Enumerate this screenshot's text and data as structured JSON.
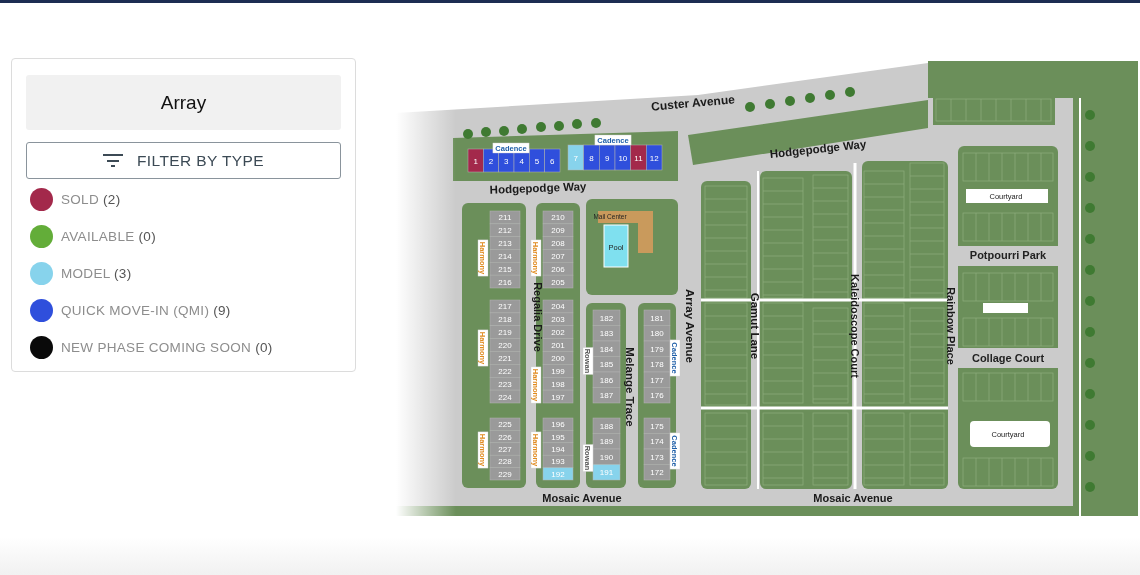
{
  "panel": {
    "title": "Array",
    "filter_button": "FILTER BY TYPE",
    "legend": [
      {
        "label": "SOLD",
        "count": "(2)",
        "color": "#a3294b"
      },
      {
        "label": "AVAILABLE",
        "count": "(0)",
        "color": "#63ad39"
      },
      {
        "label": "MODEL",
        "count": "(3)",
        "color": "#87d3ec"
      },
      {
        "label": "QUICK MOVE-IN (QMI)",
        "count": "(9)",
        "color": "#2f4fdc"
      },
      {
        "label": "NEW PHASE COMING SOON",
        "count": "(0)",
        "color": "#0a0a0a"
      }
    ]
  },
  "map": {
    "streets": [
      "Custer Avenue",
      "Hodgepodge Way",
      "Hodgepodge Way",
      "Regalia Drive",
      "Melange Trace",
      "Array Avenue",
      "Gamut Lane",
      "Kaleidoscope Court",
      "Rainbow Place",
      "Mosaic Avenue",
      "Mosaic Avenue"
    ],
    "places": [
      "Mail Center",
      "Pool",
      "Courtyard",
      "Potpourri Park",
      "Collage Court",
      "Courtyard"
    ],
    "builder_tags": [
      {
        "text": "Cadence",
        "color": "#1f5fa8"
      },
      {
        "text": "Cadence",
        "color": "#1f5fa8"
      },
      {
        "text": "Cadence",
        "color": "#1f5fa8"
      },
      {
        "text": "Cadence",
        "color": "#1f5fa8"
      },
      {
        "text": "Harmony",
        "color": "#e08a1e"
      },
      {
        "text": "Harmony",
        "color": "#e08a1e"
      },
      {
        "text": "Harmony",
        "color": "#e08a1e"
      },
      {
        "text": "Harmony",
        "color": "#e08a1e"
      },
      {
        "text": "Harmony",
        "color": "#e08a1e"
      },
      {
        "text": "Harmony",
        "color": "#e08a1e"
      },
      {
        "text": "Rowan",
        "color": "#555555"
      },
      {
        "text": "Rowan",
        "color": "#555555"
      }
    ],
    "lot_blocks": [
      {
        "lots": [
          {
            "number": "1",
            "color": "#a3294b"
          },
          {
            "number": "2",
            "color": "#2f4fdc"
          },
          {
            "number": "3",
            "color": "#2f4fdc"
          },
          {
            "number": "4",
            "color": "#2f4fdc"
          },
          {
            "number": "5",
            "color": "#2f4fdc"
          },
          {
            "number": "6",
            "color": "#2f4fdc"
          }
        ]
      },
      {
        "lots": [
          {
            "number": "7",
            "color": "#87d3ec"
          },
          {
            "number": "8",
            "color": "#2f4fdc"
          },
          {
            "number": "9",
            "color": "#2f4fdc"
          },
          {
            "number": "10",
            "color": "#2f4fdc"
          },
          {
            "number": "11",
            "color": "#a3294b"
          },
          {
            "number": "12",
            "color": "#2f4fdc"
          }
        ]
      },
      {
        "lots": [
          {
            "number": "211",
            "color": "#9a9a9a"
          },
          {
            "number": "212",
            "color": "#9a9a9a"
          },
          {
            "number": "213",
            "color": "#9a9a9a"
          },
          {
            "number": "214",
            "color": "#9a9a9a"
          },
          {
            "number": "215",
            "color": "#9a9a9a"
          },
          {
            "number": "216",
            "color": "#9a9a9a"
          }
        ]
      },
      {
        "lots": [
          {
            "number": "210",
            "color": "#9a9a9a"
          },
          {
            "number": "209",
            "color": "#9a9a9a"
          },
          {
            "number": "208",
            "color": "#9a9a9a"
          },
          {
            "number": "207",
            "color": "#9a9a9a"
          },
          {
            "number": "206",
            "color": "#9a9a9a"
          },
          {
            "number": "205",
            "color": "#9a9a9a"
          }
        ]
      },
      {
        "lots": [
          {
            "number": "217",
            "color": "#9a9a9a"
          },
          {
            "number": "218",
            "color": "#9a9a9a"
          },
          {
            "number": "219",
            "color": "#9a9a9a"
          },
          {
            "number": "220",
            "color": "#9a9a9a"
          },
          {
            "number": "221",
            "color": "#9a9a9a"
          },
          {
            "number": "222",
            "color": "#9a9a9a"
          },
          {
            "number": "223",
            "color": "#9a9a9a"
          },
          {
            "number": "224",
            "color": "#9a9a9a"
          }
        ]
      },
      {
        "lots": [
          {
            "number": "204",
            "color": "#9a9a9a"
          },
          {
            "number": "203",
            "color": "#9a9a9a"
          },
          {
            "number": "202",
            "color": "#9a9a9a"
          },
          {
            "number": "201",
            "color": "#9a9a9a"
          },
          {
            "number": "200",
            "color": "#9a9a9a"
          },
          {
            "number": "199",
            "color": "#9a9a9a"
          },
          {
            "number": "198",
            "color": "#9a9a9a"
          },
          {
            "number": "197",
            "color": "#9a9a9a"
          }
        ]
      },
      {
        "lots": [
          {
            "number": "182",
            "color": "#9a9a9a"
          },
          {
            "number": "183",
            "color": "#9a9a9a"
          },
          {
            "number": "184",
            "color": "#9a9a9a"
          },
          {
            "number": "185",
            "color": "#9a9a9a"
          },
          {
            "number": "186",
            "color": "#9a9a9a"
          },
          {
            "number": "187",
            "color": "#9a9a9a"
          }
        ]
      },
      {
        "lots": [
          {
            "number": "181",
            "color": "#9a9a9a"
          },
          {
            "number": "180",
            "color": "#9a9a9a"
          },
          {
            "number": "179",
            "color": "#9a9a9a"
          },
          {
            "number": "178",
            "color": "#9a9a9a"
          },
          {
            "number": "177",
            "color": "#9a9a9a"
          },
          {
            "number": "176",
            "color": "#9a9a9a"
          }
        ]
      },
      {
        "lots": [
          {
            "number": "225",
            "color": "#9a9a9a"
          },
          {
            "number": "226",
            "color": "#9a9a9a"
          },
          {
            "number": "227",
            "color": "#9a9a9a"
          },
          {
            "number": "228",
            "color": "#9a9a9a"
          },
          {
            "number": "229",
            "color": "#9a9a9a"
          }
        ]
      },
      {
        "lots": [
          {
            "number": "196",
            "color": "#9a9a9a"
          },
          {
            "number": "195",
            "color": "#9a9a9a"
          },
          {
            "number": "194",
            "color": "#9a9a9a"
          },
          {
            "number": "193",
            "color": "#9a9a9a"
          },
          {
            "number": "192",
            "color": "#87d3ec"
          }
        ]
      },
      {
        "lots": [
          {
            "number": "188",
            "color": "#9a9a9a"
          },
          {
            "number": "189",
            "color": "#9a9a9a"
          },
          {
            "number": "190",
            "color": "#9a9a9a"
          },
          {
            "number": "191",
            "color": "#87d3ec"
          }
        ]
      },
      {
        "lots": [
          {
            "number": "175",
            "color": "#9a9a9a"
          },
          {
            "number": "174",
            "color": "#9a9a9a"
          },
          {
            "number": "173",
            "color": "#9a9a9a"
          },
          {
            "number": "172",
            "color": "#9a9a9a"
          }
        ]
      }
    ]
  }
}
